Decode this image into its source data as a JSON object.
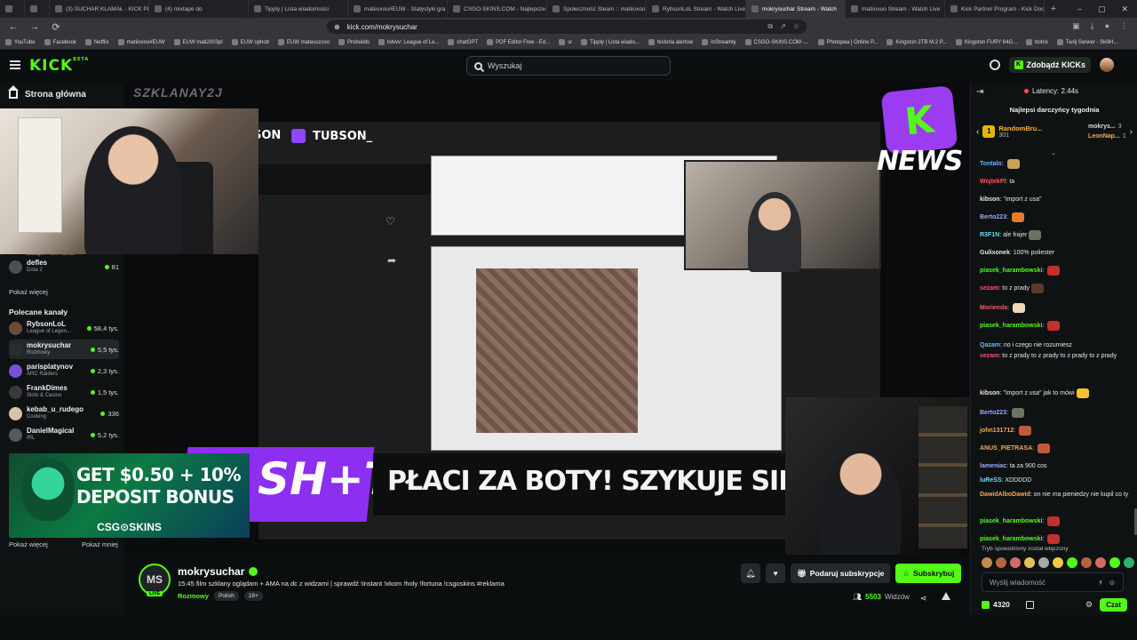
{
  "browser": {
    "tabs": [
      {
        "label": "",
        "active": false
      },
      {
        "label": "",
        "active": false
      },
      {
        "label": "(3) SUCHAR KLAMAŁ - KICK PL",
        "active": false
      },
      {
        "label": "(4) mixtape do",
        "active": false
      },
      {
        "label": "Tipply | Lista wiadomości",
        "active": false
      },
      {
        "label": "matiioxoo#EUW - Statystyki gra",
        "active": false
      },
      {
        "label": "CSGO-SKINS.COM - Najlepsze",
        "active": false
      },
      {
        "label": "Społeczność Steam :: matiioxoo",
        "active": false
      },
      {
        "label": "RybsonLoL Stream - Watch Live",
        "active": false
      },
      {
        "label": "mokrysuchar Stream - Watch",
        "active": true
      },
      {
        "label": "matiioxoo Stream - Watch Live",
        "active": false
      },
      {
        "label": "Kick Partner Program - Kick Doc",
        "active": false
      }
    ],
    "url": "kick.com/mokrysuchar",
    "bookmarks": [
      "YouTube",
      "Facebook",
      "Netflix",
      "matiioxoo#EUW",
      "EUW mati2003pl",
      "EUW ophob",
      "EUW mateuszoxo",
      "Probuilds",
      "lolvvv: League of Le...",
      "chatGPT",
      "PDF Editor Free - Ed...",
      "sr",
      "Tipply | Lista wiado...",
      "historia alertow",
      "inStreamly",
      "CSGO-SKINS.COM -...",
      "Photopea | Online P...",
      "Kingston 2TB M.2 P...",
      "Kingston FURY 64G...",
      "botrix",
      "Twój Serwer - SkillH..."
    ]
  },
  "nav": {
    "logo": "KICK",
    "logo_sup": "BETA",
    "search_placeholder": "Wyszukaj",
    "get_kicks": "Zdobądź KICKs"
  },
  "sidebar": {
    "home": "Strona główna",
    "followed_partial": "Escape From Tarkov",
    "followed": [
      {
        "name": "defles",
        "category": "Dota 2",
        "viewers": "81"
      }
    ],
    "show_more_1": "Pokaż więcej",
    "recommended_heading": "Polecane kanały",
    "recommended": [
      {
        "name": "RybsonLoL",
        "category": "League of Legen...",
        "viewers": "58,4 tys.",
        "color": "#6b4a3a",
        "active": false
      },
      {
        "name": "mokrysuchar",
        "category": "Rozmowy",
        "viewers": "5,5 tys.",
        "color": "#2a2d30",
        "active": true
      },
      {
        "name": "parisplatynov",
        "category": "ARC Raiders",
        "viewers": "2,3 tys.",
        "color": "#7b4fd6",
        "active": false
      },
      {
        "name": "FrankDimes",
        "category": "Slots & Casino",
        "viewers": "1,5 tys.",
        "color": "#3a3a3a",
        "active": false
      },
      {
        "name": "kebab_u_rudego",
        "category": "Cooking",
        "viewers": "336",
        "color": "#d9c3a5",
        "active": false
      },
      {
        "name": "DanielMagical",
        "category": "IRL",
        "viewers": "5,2 tys.",
        "color": "#555a60",
        "active": false
      }
    ],
    "show_more_2": "Pokaż więcej",
    "show_less": "Pokaż mniej"
  },
  "player": {
    "watermark": "SZKLANAY2J",
    "tubson_tag": "TUBSON_",
    "tubson_partial": "SON",
    "news_badge": "K",
    "news_label": "NEWS",
    "banner_logo": "SH+T!",
    "headline": "PŁACI ZA BOTY! SZYKUJE SIE AFERA",
    "ad": {
      "line1": "GET $0.50 + 10%",
      "line2": "DEPOSIT BONUS",
      "brand": "CSG⊙SKINS"
    }
  },
  "stream": {
    "avatar_initials": "MS",
    "live_badge": "LIVE",
    "name": "mokrysuchar",
    "title": "15:45 film szklany oglądam + AMA na dc z widzami | sprawdź !instant !xkom !holy !fortuna !csgoskins #reklama",
    "category": "Rozmowy",
    "tags": [
      "Polish",
      "18+"
    ],
    "gift_sub": "Podaruj subskrypcje",
    "subscribe": "Subskrybuj",
    "viewers": "5503",
    "viewers_label": "Widzów"
  },
  "chat": {
    "latency": "Latency: 2.44s",
    "gifters_title": "Najlepsi darczyńcy tygodnia",
    "top_gifter": {
      "rank": "1",
      "name": "RandomBru...",
      "count": "301"
    },
    "other_gifters": [
      {
        "name": "mokrys...",
        "count": "3"
      },
      {
        "name": "LeonNap...",
        "count": "1"
      }
    ],
    "messages": [
      {
        "user": "Tontalo",
        "color": "#6ab7ff",
        "text": "",
        "emote": "#c9a25a"
      },
      {
        "user": "WojtekPl",
        "color": "#ff5a5a",
        "text": "ta",
        "emote": ""
      },
      {
        "user": "kibson",
        "color": "#e6e6e6",
        "text": "\"import z usa\"",
        "emote": ""
      },
      {
        "user": "Berto223",
        "color": "#9aa9ff",
        "text": "",
        "emote": "#e87a2c"
      },
      {
        "user": "R3F1N",
        "color": "#5ee1ff",
        "text": "ale frajer",
        "emote": "#6e7361"
      },
      {
        "user": "Gulixonek",
        "color": "#e6e6e6",
        "text": "100% poliester",
        "emote": ""
      },
      {
        "user": "piasek_harambowski",
        "color": "#53fc18",
        "text": "",
        "emote": "#c4302b"
      },
      {
        "user": "sezam",
        "color": "#ff4d7a",
        "text": "to z prady",
        "emote": "#5a3a2a"
      },
      {
        "user": "Morienda",
        "color": "#ff5a5a",
        "text": "",
        "emote": "#f1d6b8"
      },
      {
        "user": "piasek_harambowski",
        "color": "#53fc18",
        "text": "",
        "emote": "#c4302b"
      },
      {
        "user": "Qazam",
        "color": "#6ab7ff",
        "text": "no i czego nie rozumiesz",
        "emote": ""
      },
      {
        "user": "sezam",
        "color": "#ff4d7a",
        "text": "to z prady  to z prady  to z prady  to z prady",
        "emote": ""
      },
      {
        "user": "kibson",
        "color": "#e6e6e6",
        "text": "\"import z usa\" jak to mówi",
        "emote": "#f4c430"
      },
      {
        "user": "Berto223",
        "color": "#9aa9ff",
        "text": "",
        "emote": "#6e7361"
      },
      {
        "user": "john131712",
        "color": "#f3a75a",
        "text": "",
        "emote": "#c25a3a"
      },
      {
        "user": "ANUS_PIETRASA",
        "color": "#f3a75a",
        "text": "",
        "emote": "#c25a3a"
      },
      {
        "user": "lameniac",
        "color": "#9aa9ff",
        "text": "ta za 900 cos",
        "emote": ""
      },
      {
        "user": "luReSS",
        "color": "#5ee1ff",
        "text": "XDDDDD",
        "emote": ""
      },
      {
        "user": "DawidAlboDawid",
        "color": "#f3a75a",
        "text": "on nie ma pieniedzy nie kupil co ty",
        "emote": ""
      },
      {
        "user": "piasek_harambowski",
        "color": "#53fc18",
        "text": "",
        "emote": "#c4302b"
      },
      {
        "user": "piasek_harambowski",
        "color": "#53fc18",
        "text": "",
        "emote": "#c4302b"
      }
    ],
    "slow_mode": "Tryb spowolniony został włączony",
    "input_placeholder": "Wyślij wiadomość",
    "kicks": "4320",
    "send": "Czat"
  },
  "colors": {
    "brand": "#53fc18",
    "background": "#0b0e0f",
    "panel": "#0f1213"
  }
}
